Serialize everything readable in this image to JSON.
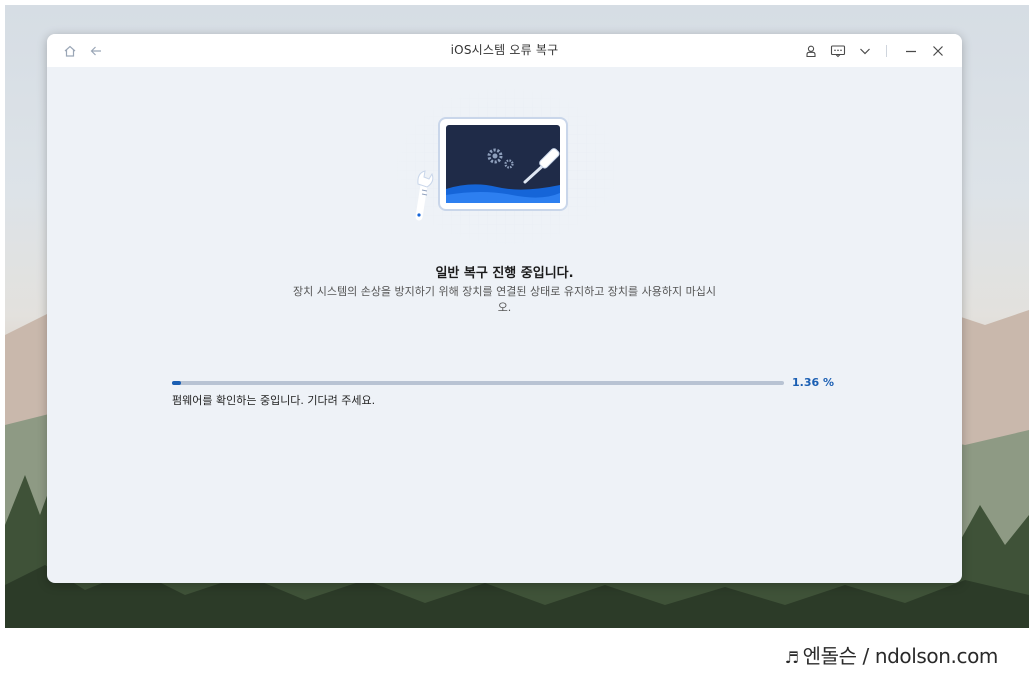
{
  "window": {
    "title": "iOS시스템 오류 복구"
  },
  "titlebar_icons": {
    "home": "home-icon",
    "back": "back-arrow-icon",
    "account": "user-icon",
    "feedback": "feedback-icon",
    "menu": "chevron-down-icon",
    "minimize": "minimize-icon",
    "close": "close-icon"
  },
  "main": {
    "heading": "일반 복구 진행 중입니다.",
    "description": "장치 시스템의 손상을 방지하기 위해 장치를 연결된 상태로 유지하고 장치를 사용하지 마십시오.",
    "progress": {
      "value_percent": 1.36,
      "label": "1.36 %",
      "status_text": "펌웨어를 확인하는 중입니다. 기다려 주세요."
    }
  },
  "watermark": {
    "symbol": "♬",
    "text": "엔돌슨 / ndolson.com"
  },
  "colors": {
    "accent": "#1b5fb3",
    "window_bg": "#eef2f7",
    "track": "#b8c3d3"
  }
}
